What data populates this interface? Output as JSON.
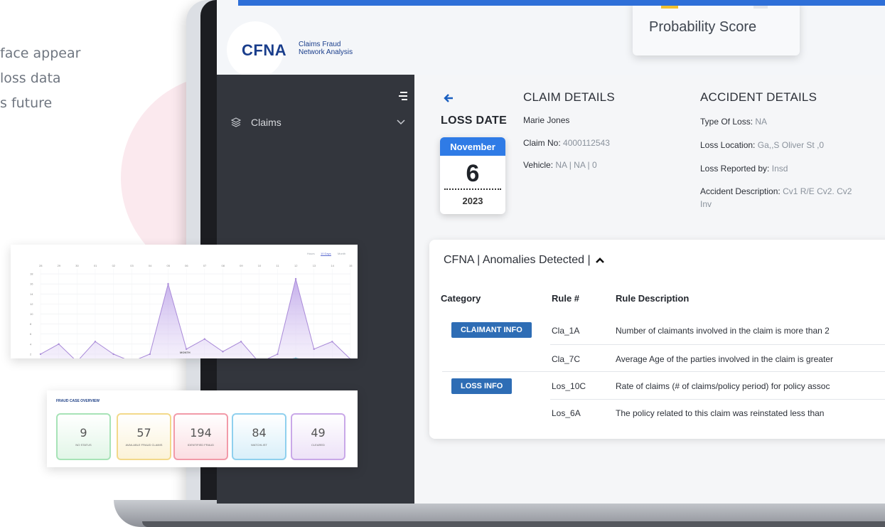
{
  "marketing": {
    "text": "face appear\nloss data\ns future"
  },
  "app": {
    "logo": "CFNA",
    "logo_sub": "Claims Fraud\nNetwork Analysis"
  },
  "probability": {
    "label": "Probability Score"
  },
  "sidebar": {
    "items": [
      {
        "label": "Claims",
        "icon": "layers-icon"
      }
    ]
  },
  "loss_date": {
    "title": "LOSS DATE",
    "month": "November",
    "day": "6",
    "year": "2023"
  },
  "claim": {
    "title": "CLAIM DETAILS",
    "name": "Marie Jones",
    "claim_no_label": "Claim No:",
    "claim_no": "4000112543",
    "vehicle_label": "Vehicle:",
    "vehicle": "NA | NA | 0"
  },
  "accident": {
    "title": "ACCIDENT DETAILS",
    "type_label": "Type Of Loss:",
    "type": "NA",
    "location_label": "Loss Location:",
    "location": "Ga,,S Oliver St ,0",
    "reported_label": "Loss Reported by:",
    "reported": "Insd",
    "desc_label": "Accident Description:",
    "desc": "Cv1 R/E Cv2. Cv2",
    "desc_cont": "Inv"
  },
  "anomalies": {
    "title": "CFNA | Anomalies Detected |",
    "headers": {
      "category": "Category",
      "rule": "Rule #",
      "description": "Rule Description"
    },
    "tags": {
      "claimant": "CLAIMANT INFO",
      "loss": "LOSS INFO"
    },
    "rows": [
      {
        "rule": "Cla_1A",
        "desc": "Number of claimants involved in the claim is more than 2"
      },
      {
        "rule": "Cla_7C",
        "desc": "Average Age of the parties involved in the claim is greater"
      },
      {
        "rule": "Los_10C",
        "desc": "Rate of claims (# of claims/policy period) for policy assoc"
      },
      {
        "rule": "Los_6A",
        "desc": "The policy related to this claim was reinstated less than"
      }
    ]
  },
  "mini_chart": {
    "tabs": [
      "Hours",
      "10 Days",
      "Month"
    ],
    "xlabel": "MONTH",
    "top_labels": [
      "28",
      "29",
      "30",
      "01",
      "02",
      "03",
      "04",
      "05",
      "06",
      "07",
      "08",
      "09",
      "10",
      "11",
      "12",
      "13",
      "14",
      "15"
    ],
    "y_ticks": [
      "0",
      "2",
      "4",
      "6",
      "8",
      "10",
      "12",
      "14",
      "16",
      "18"
    ]
  },
  "chart_data": {
    "type": "area",
    "x": [
      "28",
      "29",
      "30",
      "01",
      "02",
      "03",
      "04",
      "05",
      "06",
      "07",
      "08",
      "09",
      "10",
      "11",
      "12",
      "13",
      "14",
      "15"
    ],
    "series": [
      {
        "values": [
          2,
          4,
          0.5,
          4.5,
          2,
          0.5,
          2,
          16,
          3,
          5,
          2.5,
          4.5,
          0.3,
          2,
          17,
          3,
          4.5,
          1
        ]
      },
      {
        "values": [
          0.3,
          0.5,
          0.1,
          0.4,
          0.8,
          0.2,
          0.4,
          0.9,
          0.3,
          1.0,
          0.2,
          0.6,
          0.1,
          0.5,
          1.2,
          0.4,
          0.8,
          0.2
        ]
      }
    ],
    "xlabel": "MONTH",
    "ylim": [
      0,
      19
    ]
  },
  "overview": {
    "title": "FRAUD CASE OVERVIEW",
    "kpis": [
      {
        "value": "9",
        "label": "NO STATUS",
        "color": "#a7e3b7"
      },
      {
        "value": "57",
        "label": "AVAILABLE FRAUD CLAIMS",
        "color": "#f3d98a"
      },
      {
        "value": "194",
        "label": "IDENTIFIED FRAUD",
        "color": "#f29aa8"
      },
      {
        "value": "84",
        "label": "WATCHLIST",
        "color": "#8fd0ee"
      },
      {
        "value": "49",
        "label": "CLEARED",
        "color": "#c9a8e8"
      }
    ]
  }
}
